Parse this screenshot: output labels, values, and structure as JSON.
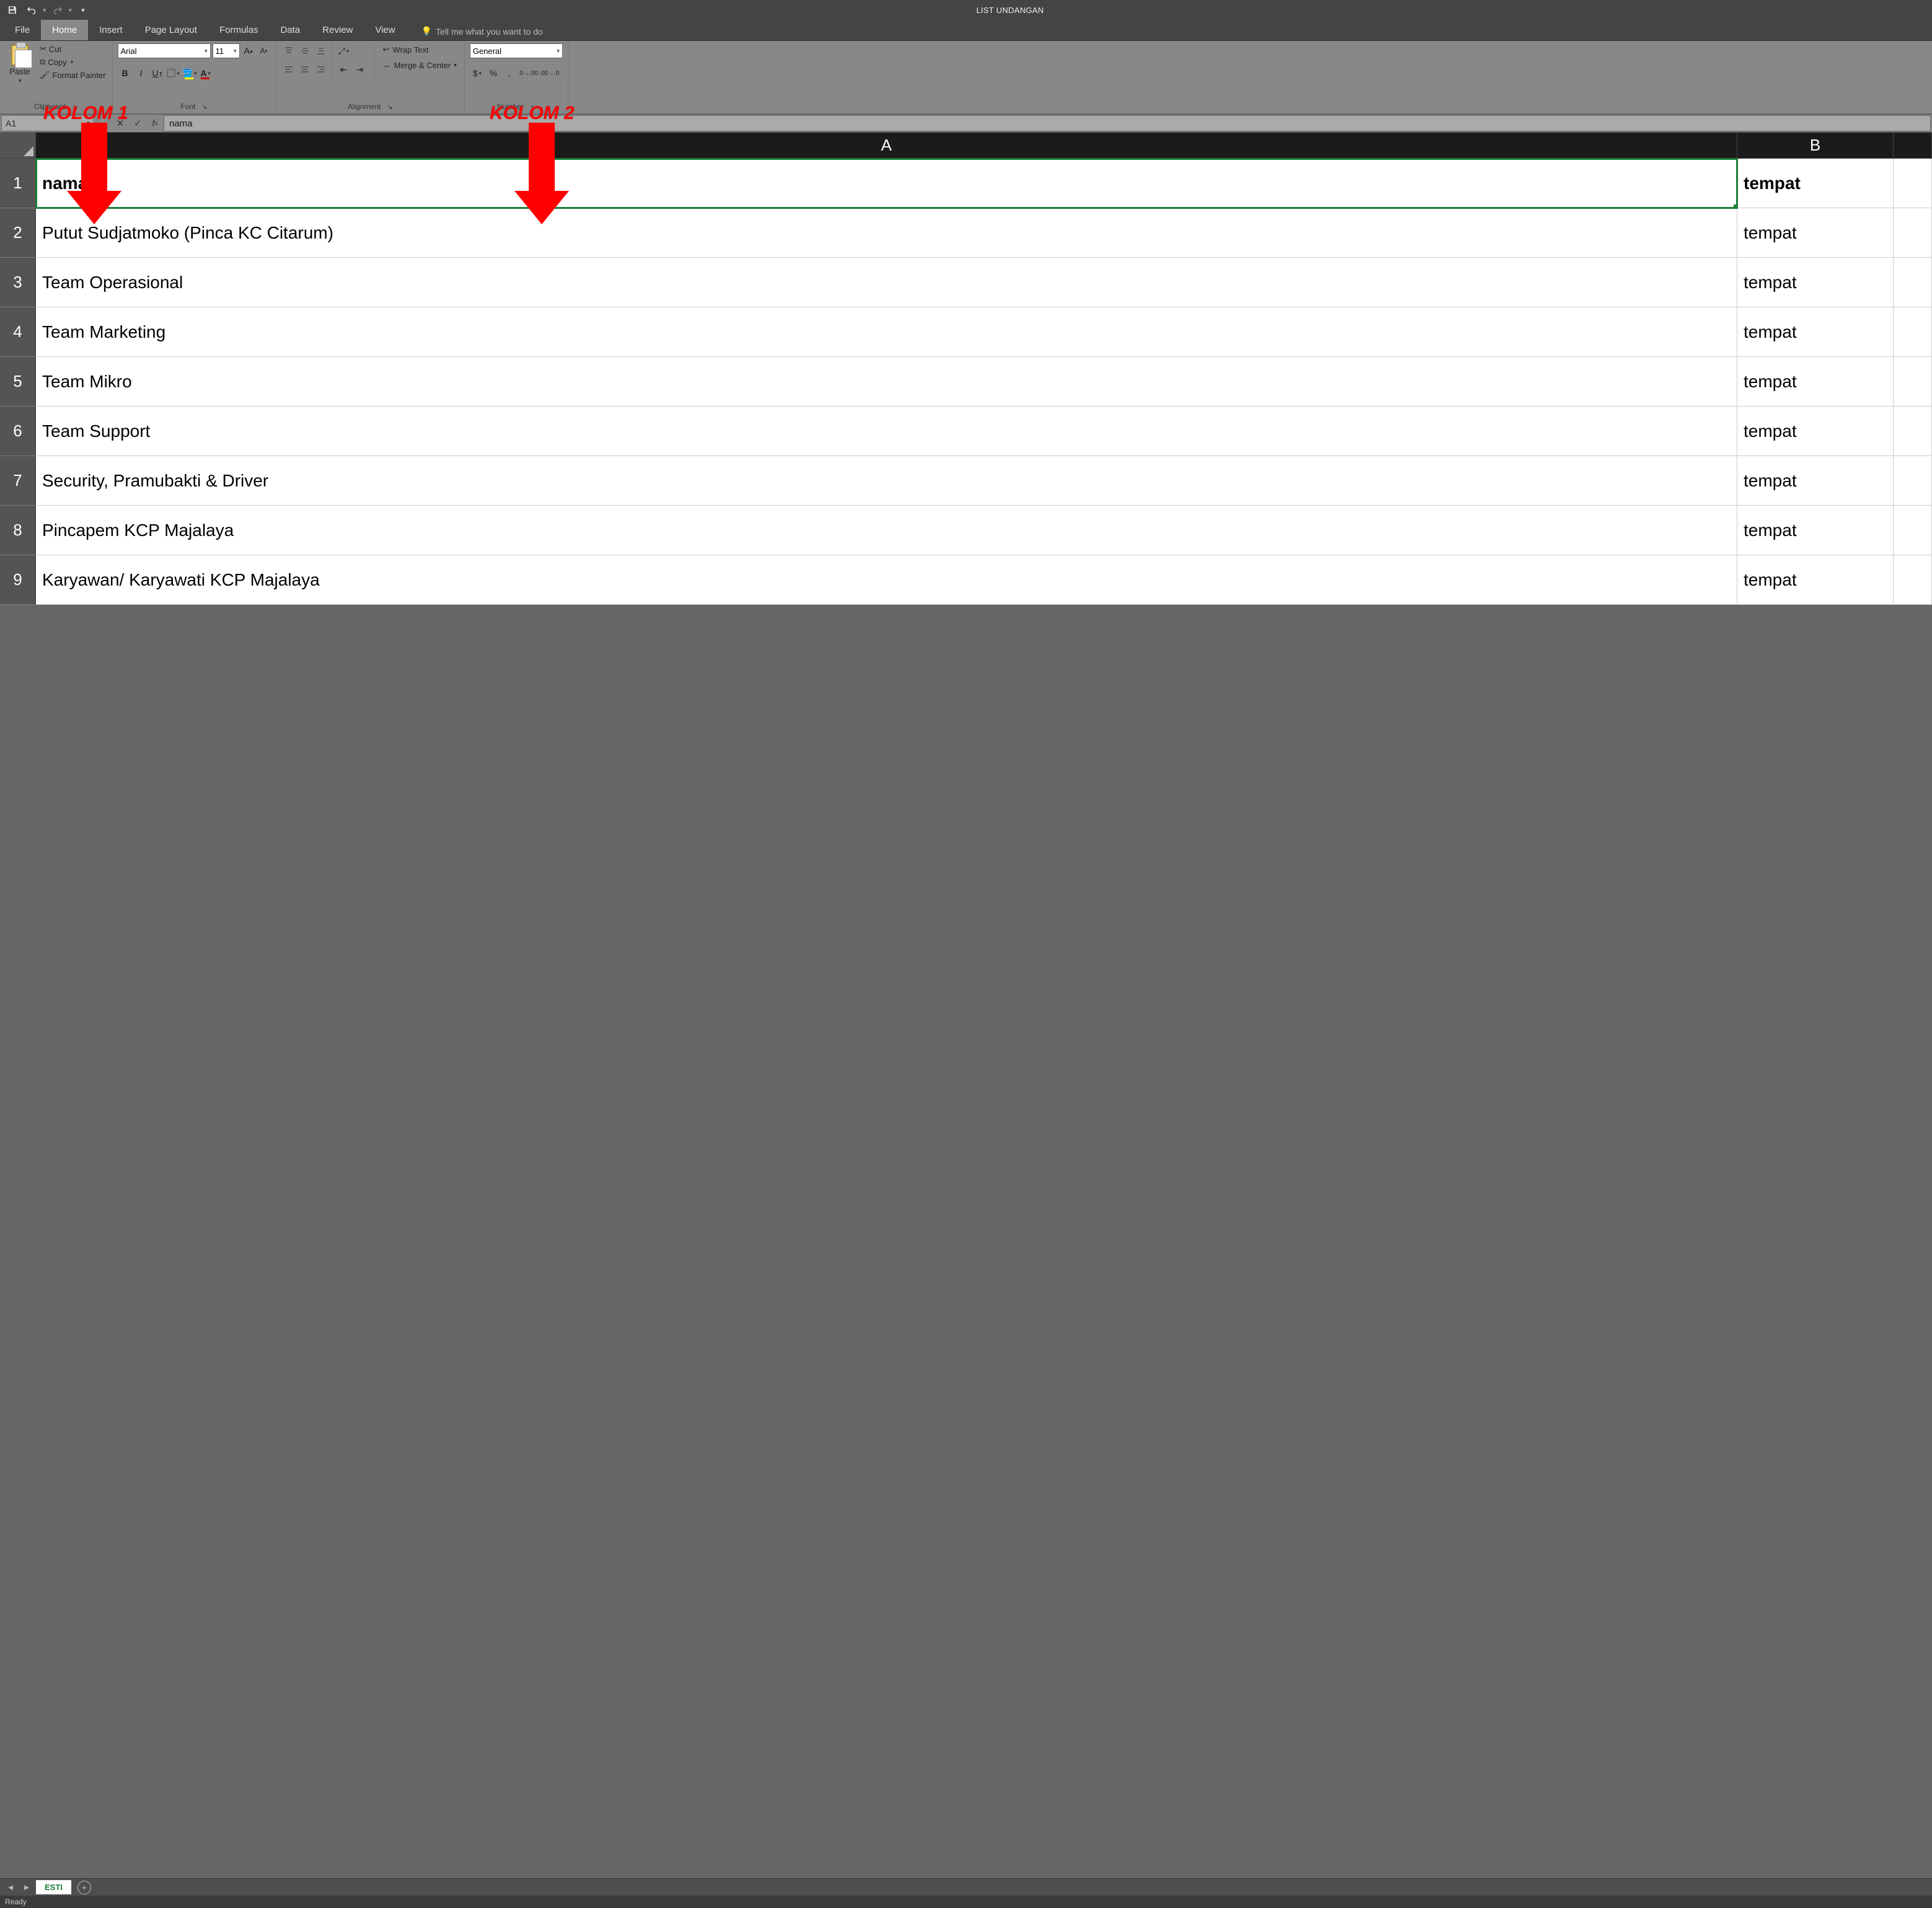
{
  "titlebar": {
    "document_title": "LIST UNDANGAN"
  },
  "ribbon_tabs": {
    "file": "File",
    "home": "Home",
    "insert": "Insert",
    "page_layout": "Page Layout",
    "formulas": "Formulas",
    "data": "Data",
    "review": "Review",
    "view": "View",
    "tellme_placeholder": "Tell me what you want to do"
  },
  "clipboard": {
    "paste": "Paste",
    "cut": "Cut",
    "copy": "Copy",
    "format_painter": "Format Painter",
    "group": "Clipboard"
  },
  "font": {
    "name": "Arial",
    "size": "11",
    "group": "Font"
  },
  "alignment": {
    "wrap_text": "Wrap Text",
    "merge_center": "Merge & Center",
    "group": "Alignment"
  },
  "number": {
    "format": "General",
    "percent": "%",
    "comma": ",",
    "inc_dec": ".00",
    "group": "Number"
  },
  "namebox": {
    "value": "A1"
  },
  "formula_bar": {
    "value": "nama"
  },
  "columns": {
    "A": "A",
    "B": "B",
    "C": ""
  },
  "rows": [
    {
      "n": "1",
      "A": "nama",
      "B": "tempat",
      "bold": true
    },
    {
      "n": "2",
      "A": "Putut Sudjatmoko (Pinca KC Citarum)",
      "B": "tempat"
    },
    {
      "n": "3",
      "A": "Team Operasional",
      "B": "tempat"
    },
    {
      "n": "4",
      "A": "Team Marketing",
      "B": "tempat"
    },
    {
      "n": "5",
      "A": "Team Mikro",
      "B": "tempat"
    },
    {
      "n": "6",
      "A": "Team Support",
      "B": "tempat"
    },
    {
      "n": "7",
      "A": "Security, Pramubakti & Driver",
      "B": "tempat"
    },
    {
      "n": "8",
      "A": "Pincapem KCP Majalaya",
      "B": "tempat"
    },
    {
      "n": "9",
      "A": "Karyawan/ Karyawati KCP Majalaya",
      "B": "tempat"
    }
  ],
  "sheet": {
    "name": "ESTI"
  },
  "status": {
    "ready": "Ready"
  },
  "annotations": {
    "k1": "KOLOM 1",
    "k2": "KOLOM 2"
  }
}
